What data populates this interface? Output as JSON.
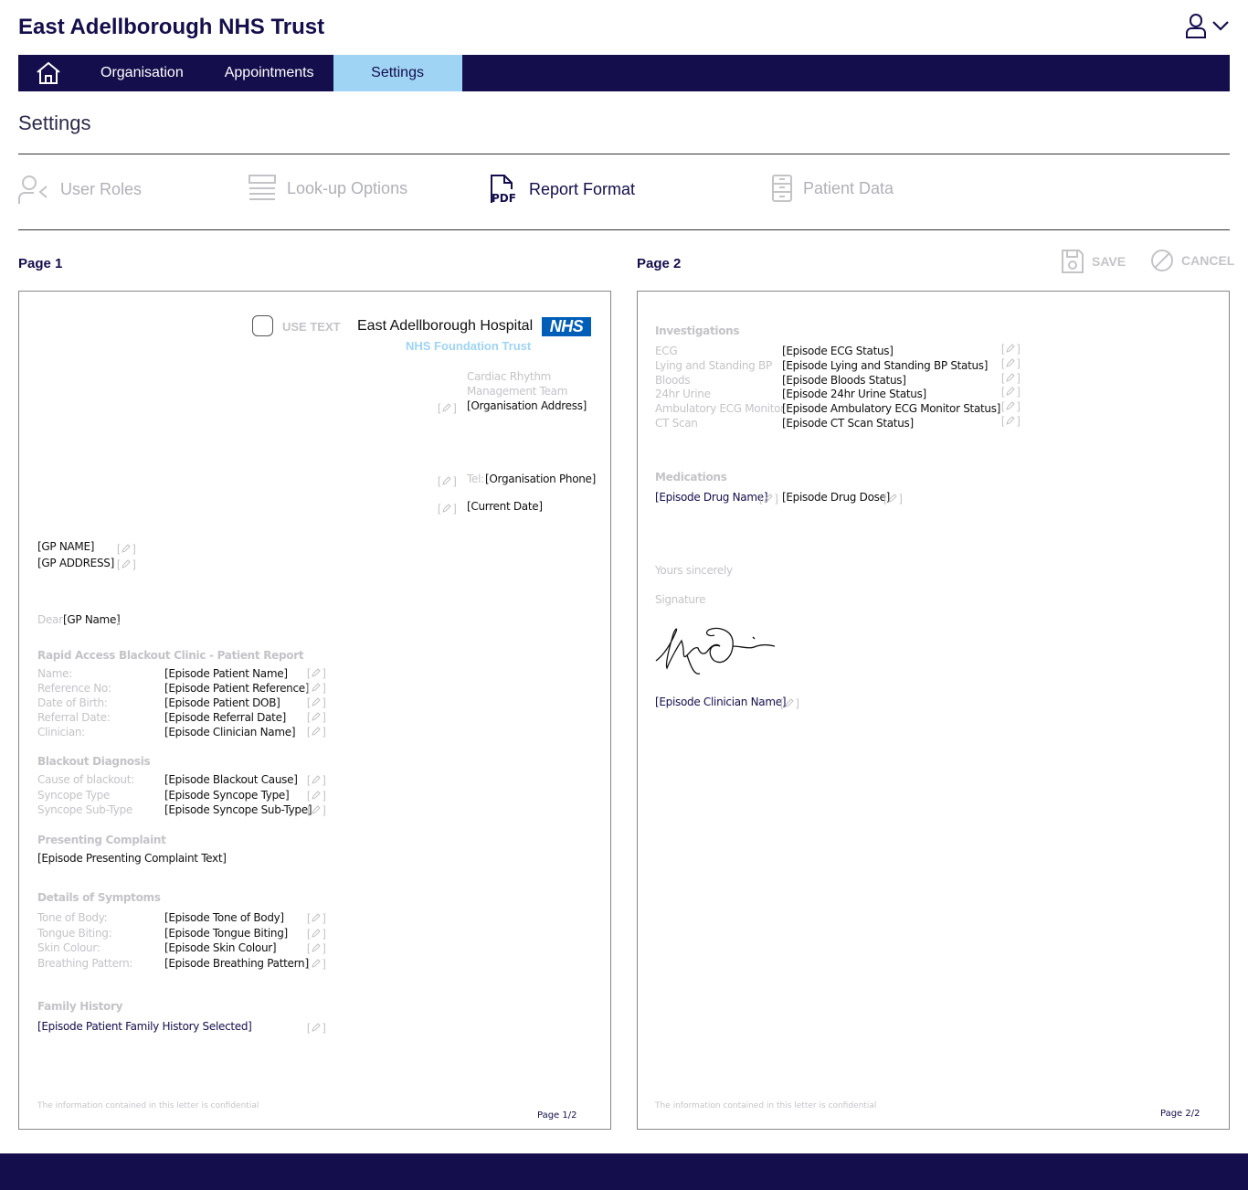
{
  "header": {
    "title": "East Adellborough NHS Trust"
  },
  "nav": {
    "items": [
      "Organisation",
      "Appointments",
      "Settings"
    ]
  },
  "page": {
    "title": "Settings"
  },
  "subtabs": [
    "User Roles",
    "Look-up Options",
    "Report Format",
    "Patient Data"
  ],
  "pdf_icon_text": "PDF",
  "columns": {
    "page1": "Page 1",
    "page2": "Page 2"
  },
  "actions": {
    "save": "SAVE",
    "cancel": "CANCEL"
  },
  "page1": {
    "use_text": "USE TEXT",
    "hospital": "East Adellborough Hospital",
    "logo": "NHS",
    "foundation": "NHS Foundation Trust",
    "team_line1": "Cardiac Rhythm",
    "team_line2": "Management Team",
    "org_address": "[Organisation Address]",
    "tel_label": "Tel:",
    "org_phone": "[Organisation Phone]",
    "current_date": "[Current Date]",
    "gp_name": "[GP NAME]",
    "gp_address": "[GP ADDRESS]",
    "dear": "Dear",
    "dear_name": "[GP Name]",
    "dear_comma": ",",
    "report_heading": "Rapid Access Blackout Clinic - Patient Report",
    "report_rows": [
      {
        "label": "Name:",
        "value": "[Episode Patient Name]"
      },
      {
        "label": "Reference No:",
        "value": "[Episode Patient Reference]"
      },
      {
        "label": "Date of Birth:",
        "value": "[Episode Patient DOB]"
      },
      {
        "label": "Referral Date:",
        "value": "[Episode Referral Date]"
      },
      {
        "label": "Clinician:",
        "value": "[Episode Clinician Name]"
      }
    ],
    "diagnosis_heading": "Blackout Diagnosis",
    "diagnosis_rows": [
      {
        "label": "Cause of blackout:",
        "value": "[Episode Blackout Cause]"
      },
      {
        "label": "Syncope Type",
        "value": "[Episode Syncope Type]"
      },
      {
        "label": "Syncope Sub-Type",
        "value": "[Episode Syncope Sub-Type]"
      }
    ],
    "complaint_heading": "Presenting Complaint",
    "complaint_value": "[Episode Presenting Complaint Text]",
    "symptoms_heading": "Details of Symptoms",
    "symptoms_rows": [
      {
        "label": "Tone of Body:",
        "value": "[Episode Tone of Body]"
      },
      {
        "label": "Tongue Biting:",
        "value": "[Episode Tongue Biting]"
      },
      {
        "label": "Skin Colour:",
        "value": "[Episode Skin Colour]"
      },
      {
        "label": "Breathing Pattern:",
        "value": "[Episode Breathing Pattern]"
      }
    ],
    "family_heading": "Family History",
    "family_value": "[Episode Patient Family History Selected]",
    "footer_note": "The information contained in this letter is confidential",
    "page_num": "Page 1/2"
  },
  "page2": {
    "investigations_heading": "Investigations",
    "investigations_rows": [
      {
        "label": "ECG",
        "value": "[Episode ECG Status]"
      },
      {
        "label": "Lying and Standing BP",
        "value": "[Episode Lying and Standing BP Status]"
      },
      {
        "label": "Bloods",
        "value": "[Episode Bloods Status]"
      },
      {
        "label": "24hr Urine",
        "value": "[Episode 24hr Urine Status]"
      },
      {
        "label": "Ambulatory ECG Monitor",
        "value": "[Episode Ambulatory ECG Monitor Status]"
      },
      {
        "label": "CT Scan",
        "value": "[Episode CT Scan Status]"
      }
    ],
    "medications_heading": "Medications",
    "drug_name": "[Episode Drug Name]",
    "drug_dose": "[Episode Drug Dose]",
    "yours": "Yours sincerely",
    "signature_label": "Signature",
    "clinician": "[Episode Clinician Name]",
    "footer_note": "The information contained in this letter is confidential",
    "page_num": "Page 2/2"
  }
}
